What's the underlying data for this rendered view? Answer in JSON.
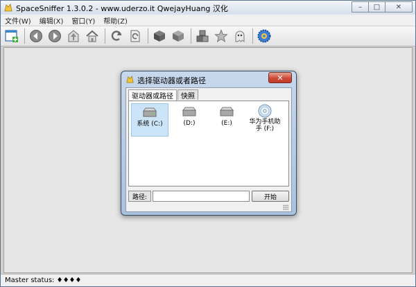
{
  "window": {
    "title": "SpaceSniffer 1.3.0.2 - www.uderzo.it  QwejayHuang 汉化",
    "controls": {
      "minimize": "–",
      "maximize": "□",
      "close": "✕"
    }
  },
  "menu": [
    "文件(W)",
    "编辑(X)",
    "窗口(Y)",
    "帮助(Z)"
  ],
  "toolbar": {
    "buttons": [
      "new-window-icon",
      "back-icon",
      "forward-icon",
      "up-icon",
      "home-icon",
      "refresh-icon",
      "refresh-doc-icon",
      "cube-dark-icon",
      "cube-light-icon",
      "cubes-icon",
      "star-icon",
      "ghost-icon",
      "gear-icon"
    ]
  },
  "status": {
    "text": "Master status: ♦♦♦♦"
  },
  "dialog": {
    "title": "选择驱动器或者路径",
    "close": "✕",
    "tabs": [
      {
        "label": "驱动器或路径",
        "active": true
      },
      {
        "label": "快照",
        "active": false
      }
    ],
    "drives": [
      {
        "label": "系统 (C:)",
        "type": "hdd",
        "selected": true
      },
      {
        "label": "(D:)",
        "type": "hdd",
        "selected": false
      },
      {
        "label": "(E:)",
        "type": "hdd",
        "selected": false
      },
      {
        "label": "华为手机助\n手 (F:)",
        "type": "cd",
        "selected": false
      }
    ],
    "path_label": "路径:",
    "path_value": "",
    "start_label": "开始"
  }
}
